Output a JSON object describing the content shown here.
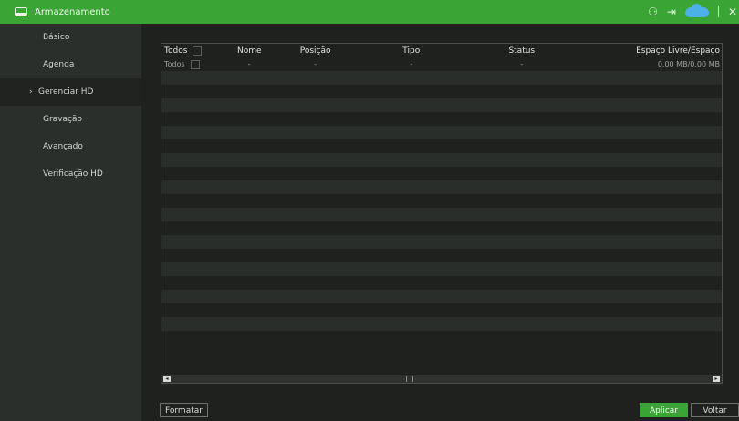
{
  "window": {
    "title": "Armazenamento"
  },
  "title_actions": [
    {
      "icon": "user-settings-icon"
    },
    {
      "icon": "logout-icon"
    },
    {
      "icon": "cloud-icon"
    },
    {
      "icon": "close-icon"
    }
  ],
  "sidebar": {
    "items": [
      {
        "label": "Básico"
      },
      {
        "label": "Agenda"
      },
      {
        "label": "Gerenciar HD",
        "active": true
      },
      {
        "label": "Gravação"
      },
      {
        "label": "Avançado"
      },
      {
        "label": "Verificação HD"
      }
    ]
  },
  "table": {
    "headers": {
      "todos": "Todos",
      "nome": "Nome",
      "posicao": "Posição",
      "tipo": "Tipo",
      "status": "Status",
      "espaco": "Espaço Livre/Espaço"
    },
    "rows": [
      {
        "todos": "Todos",
        "nome": "-",
        "posicao": "-",
        "tipo": "-",
        "status": "-",
        "espaco": "0.00 MB/0.00 MB"
      }
    ],
    "empty_rows": 20
  },
  "buttons": {
    "format": "Formatar",
    "apply": "Aplicar",
    "back": "Voltar"
  },
  "colors": {
    "accent": "#3aa535",
    "sidebar_bg": "#2b2f2b",
    "main_bg": "#1e211e"
  }
}
